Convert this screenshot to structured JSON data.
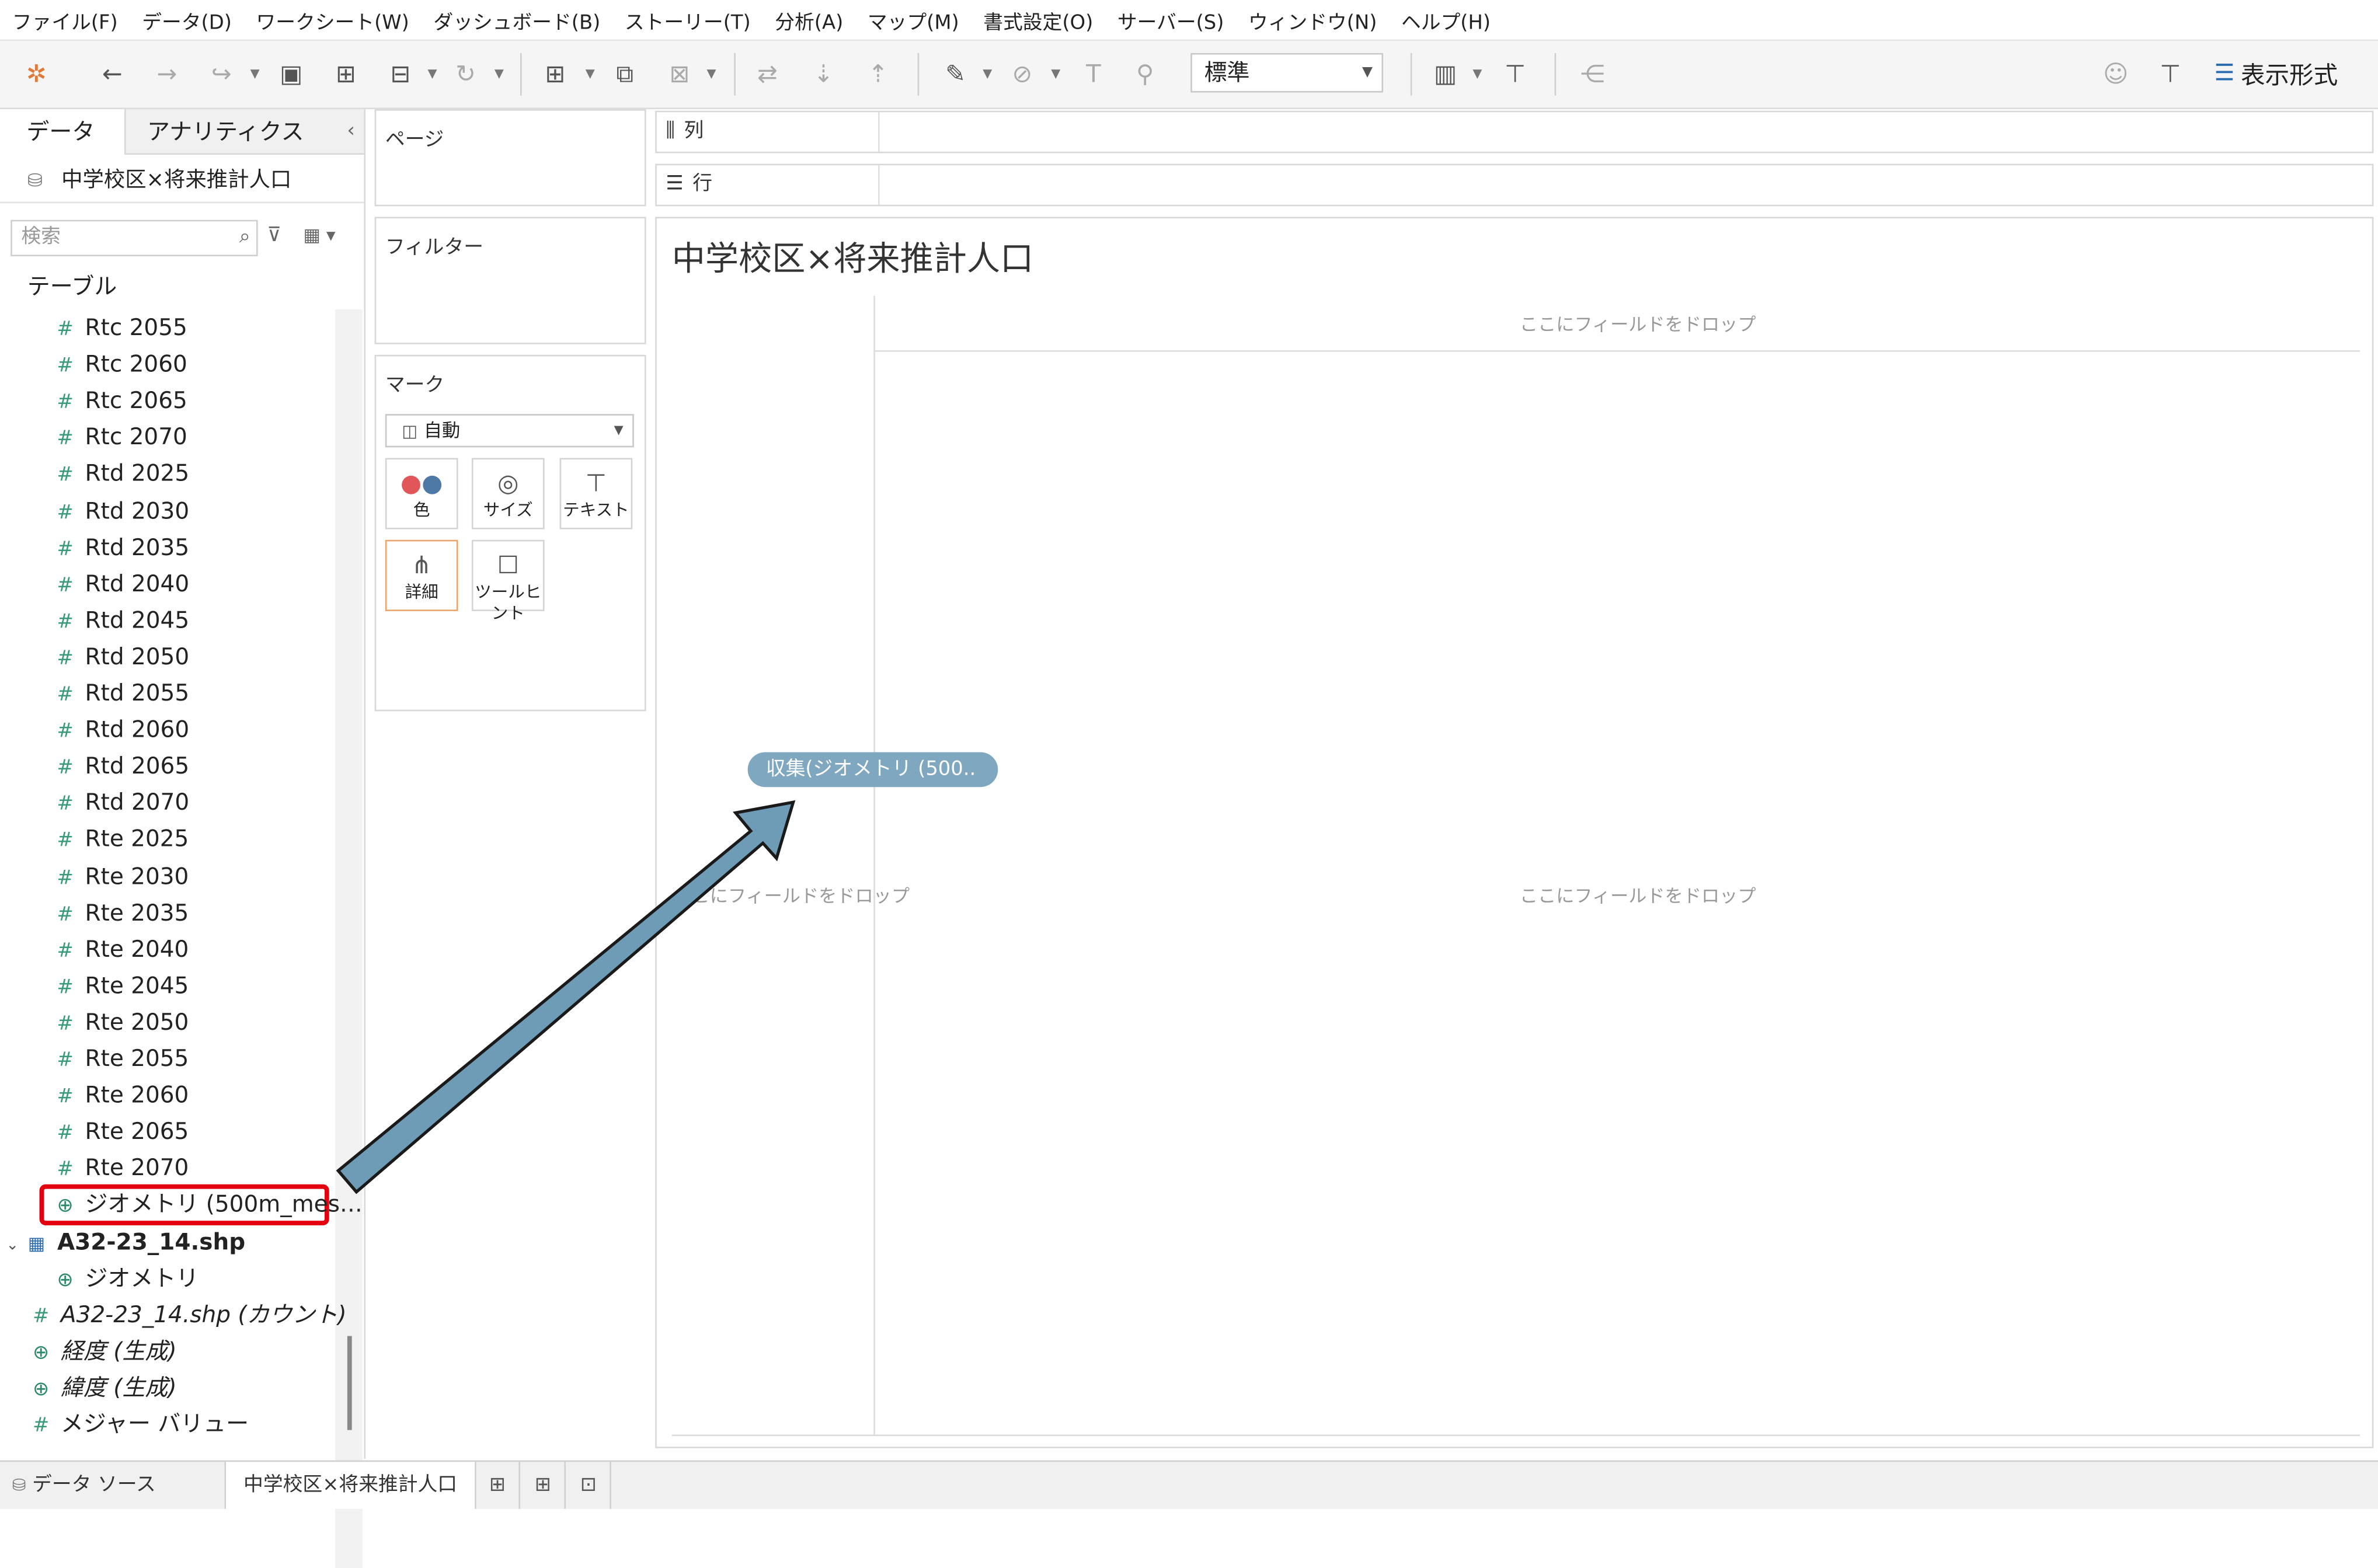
{
  "menu": [
    "ファイル(F)",
    "データ(D)",
    "ワークシート(W)",
    "ダッシュボード(B)",
    "ストーリー(T)",
    "分析(A)",
    "マップ(M)",
    "書式設定(O)",
    "サーバー(S)",
    "ウィンドウ(N)",
    "ヘルプ(H)"
  ],
  "toolbar": {
    "fit_value": "標準",
    "show_me_label": "表示形式"
  },
  "data_pane": {
    "tab_data": "データ",
    "tab_analytics": "アナリティクス",
    "datasource": "中学校区×将来推計人口",
    "search_placeholder": "検索",
    "tables_header": "テーブル",
    "fields": [
      {
        "label": "Rtc 2055",
        "type": "measure"
      },
      {
        "label": "Rtc 2060",
        "type": "measure"
      },
      {
        "label": "Rtc 2065",
        "type": "measure"
      },
      {
        "label": "Rtc 2070",
        "type": "measure"
      },
      {
        "label": "Rtd 2025",
        "type": "measure"
      },
      {
        "label": "Rtd 2030",
        "type": "measure"
      },
      {
        "label": "Rtd 2035",
        "type": "measure"
      },
      {
        "label": "Rtd 2040",
        "type": "measure"
      },
      {
        "label": "Rtd 2045",
        "type": "measure"
      },
      {
        "label": "Rtd 2050",
        "type": "measure"
      },
      {
        "label": "Rtd 2055",
        "type": "measure"
      },
      {
        "label": "Rtd 2060",
        "type": "measure"
      },
      {
        "label": "Rtd 2065",
        "type": "measure"
      },
      {
        "label": "Rtd 2070",
        "type": "measure"
      },
      {
        "label": "Rte 2025",
        "type": "measure"
      },
      {
        "label": "Rte 2030",
        "type": "measure"
      },
      {
        "label": "Rte 2035",
        "type": "measure"
      },
      {
        "label": "Rte 2040",
        "type": "measure"
      },
      {
        "label": "Rte 2045",
        "type": "measure"
      },
      {
        "label": "Rte 2050",
        "type": "measure"
      },
      {
        "label": "Rte 2055",
        "type": "measure"
      },
      {
        "label": "Rte 2060",
        "type": "measure"
      },
      {
        "label": "Rte 2065",
        "type": "measure"
      },
      {
        "label": "Rte 2070",
        "type": "measure"
      },
      {
        "label": "ジオメトリ (500m_mes…",
        "type": "geo"
      }
    ],
    "table2_name": "A32-23_14.shp",
    "table2_field": "ジオメトリ",
    "extra_fields": [
      {
        "label": "A32-23_14.shp (カウント)",
        "type": "measure"
      },
      {
        "label": "経度 (生成)",
        "type": "geo"
      },
      {
        "label": "緯度 (生成)",
        "type": "geo"
      },
      {
        "label": "メジャー バリュー",
        "type": "measure"
      }
    ]
  },
  "shelves": {
    "pages": "ページ",
    "filters": "フィルター",
    "marks": "マーク",
    "marks_type": "自動",
    "mark_buttons": [
      "色",
      "サイズ",
      "テキスト",
      "詳細",
      "ツールヒント"
    ],
    "columns": "列",
    "rows": "行"
  },
  "canvas": {
    "title": "中学校区×将来推計人口",
    "drop_hint": "ここにフィールドをドロップ",
    "pill": "収集(ジオメトリ (500.."
  },
  "bottom": {
    "datasource_tab": "データ ソース",
    "sheet_tab": "中学校区×将来推計人口"
  },
  "colors": {
    "highlight_red": "#e3000f",
    "arrow_fill": "#6e9bb5",
    "pill": "#7fa7c0",
    "measure_icon": "#3a9a78"
  }
}
